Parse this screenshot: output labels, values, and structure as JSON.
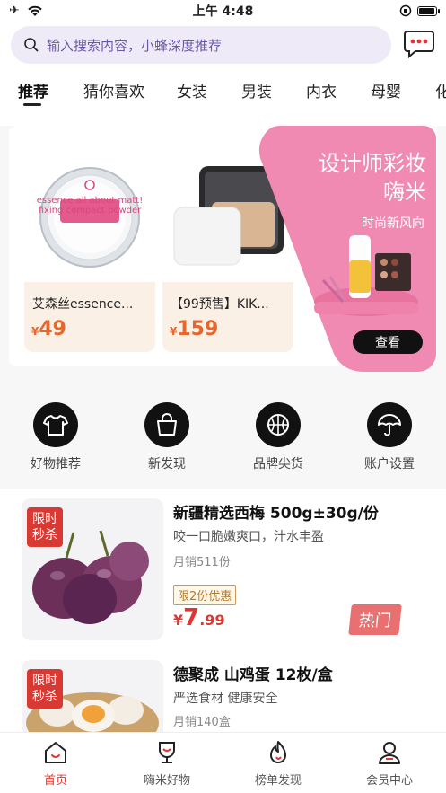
{
  "status_bar": {
    "time": "上午 4:48"
  },
  "search": {
    "placeholder": "输入搜索内容，小蜂深度推荐"
  },
  "category_tabs": [
    {
      "label": "推荐"
    },
    {
      "label": "猜你喜欢"
    },
    {
      "label": "女装"
    },
    {
      "label": "男装"
    },
    {
      "label": "内衣"
    },
    {
      "label": "母婴"
    },
    {
      "label": "化"
    }
  ],
  "banner": {
    "products": [
      {
        "name": "艾森丝essence...",
        "price_symbol": "¥",
        "price": "49",
        "pack_text": "essence all about matt! fixing compact powder"
      },
      {
        "name": "【99预售】KIK...",
        "price_symbol": "¥",
        "price": "159"
      }
    ],
    "promo": {
      "title_line1": "设计师彩妆",
      "title_line2": "嗨米",
      "subtitle": "时尚新风向",
      "button": "查看",
      "pink_color": "#f08ab2"
    }
  },
  "quick_entries": [
    {
      "label": "好物推荐",
      "icon": "tshirt-icon"
    },
    {
      "label": "新发现",
      "icon": "shopping-bag-icon"
    },
    {
      "label": "品牌尖货",
      "icon": "basketball-icon"
    },
    {
      "label": "账户设置",
      "icon": "umbrella-icon"
    }
  ],
  "goods": [
    {
      "flash_line1": "限时",
      "flash_line2": "秒杀",
      "title": "新疆精选西梅 500g±30g/份",
      "desc": "咬一口脆嫩爽口，汁水丰盈",
      "sales": "月销511份",
      "tag": "限2份优惠",
      "price_symbol": "¥",
      "price_int": "7",
      "price_dec": ".99",
      "hot": "热门"
    },
    {
      "flash_line1": "限时",
      "flash_line2": "秒杀",
      "title": "德聚成 山鸡蛋 12枚/盒",
      "desc": "严选食材 健康安全",
      "sales": "月销140盒"
    }
  ],
  "tab_bar": [
    {
      "label": "首页",
      "icon": "home-icon"
    },
    {
      "label": "嗨米好物",
      "icon": "trophy-icon"
    },
    {
      "label": "榜单发现",
      "icon": "flame-icon"
    },
    {
      "label": "会员中心",
      "icon": "user-icon"
    }
  ],
  "colors": {
    "accent": "#e2352f",
    "search_bg": "#eeeaf7",
    "card_bg": "#fbf0e6"
  }
}
